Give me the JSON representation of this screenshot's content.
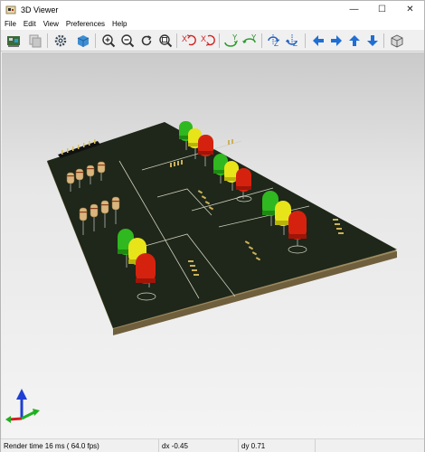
{
  "window": {
    "title": "3D Viewer"
  },
  "window_controls": {
    "minimize": "—",
    "maximize": "☐",
    "close": "✕"
  },
  "menu": {
    "file": "File",
    "edit": "Edit",
    "view": "View",
    "preferences": "Preferences",
    "help": "Help"
  },
  "toolbar": {
    "rotate_x_label": "X",
    "rotate_y_label": "Y",
    "rotate_z_label": "Z",
    "icons": [
      "render-icon",
      "copy-image-icon",
      "settings-icon",
      "board-view-icon",
      "zoom-in-icon",
      "zoom-out-icon",
      "redraw-icon",
      "zoom-fit-icon",
      "rotate-x-cw-icon",
      "rotate-x-ccw-icon",
      "rotate-y-cw-icon",
      "rotate-y-ccw-icon",
      "rotate-z-cw-icon",
      "rotate-z-ccw-icon",
      "pan-left-icon",
      "pan-right-icon",
      "pan-up-icon",
      "pan-down-icon",
      "orthographic-toggle-icon"
    ]
  },
  "colors": {
    "board": "#1d2619",
    "board_edge": "#a08c62",
    "silkscreen": "#d9d9c9",
    "pad_gold": "#cbb15a",
    "led_green": "#2fb81f",
    "led_yellow": "#e8e41a",
    "led_red": "#d5220f"
  },
  "status": {
    "render_time": "Render time 16 ms ( 64.0 fps)",
    "dx": "dx -0.45",
    "dy": "dy 0.71"
  }
}
